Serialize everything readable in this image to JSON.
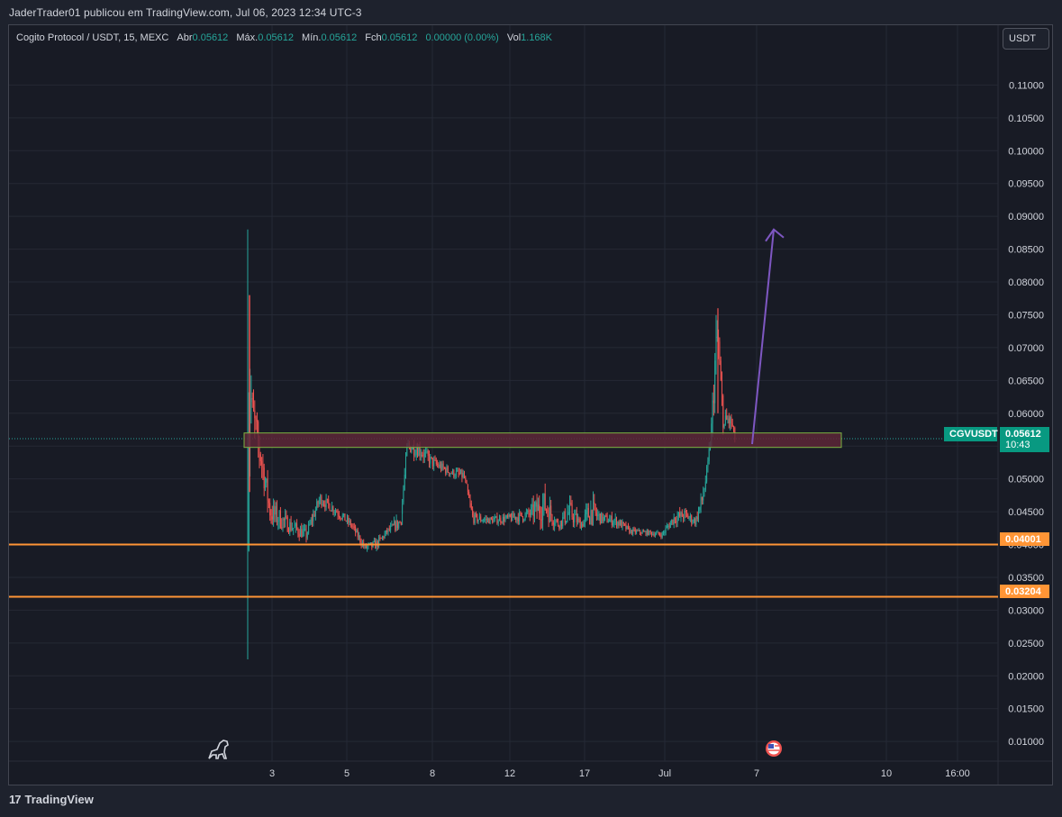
{
  "header": {
    "publish_line": "JaderTrader01 publicou em TradingView.com, Jul 06, 2023 12:34 UTC-3"
  },
  "legend": {
    "symbol": "Cogito Protocol / USDT, 15, MEXC",
    "open_label": "Abr",
    "open_value": "0.05612",
    "high_label": "Máx.",
    "high_value": "0.05612",
    "low_label": "Mín.",
    "low_value": "0.05612",
    "close_label": "Fch",
    "close_value": "0.05612",
    "change_value": "0.00000 (0.00%)",
    "volume_label": "Vol",
    "volume_value": "1.168K"
  },
  "currency_selector": "USDT",
  "footer": {
    "brand": "TradingView",
    "logo_glyph": "17"
  },
  "colors": {
    "background": "#181b25",
    "up": "#26a69a",
    "down": "#ef5350",
    "level_line": "#ff9536",
    "zone_border": "#7cb342",
    "zone_fill": "#5d2637",
    "arrow": "#7e57c2"
  },
  "chart_data": {
    "type": "candlestick",
    "title": "Cogito Protocol / USDT, 15, MEXC",
    "ylim": [
      0.007,
      0.115
    ],
    "y_ticks": [
      "0.11000",
      "0.10500",
      "0.10000",
      "0.09500",
      "0.09000",
      "0.08500",
      "0.08000",
      "0.07500",
      "0.07000",
      "0.06500",
      "0.06000",
      "0.05500",
      "0.05000",
      "0.04500",
      "0.04000",
      "0.03500",
      "0.03000",
      "0.02500",
      "0.02000",
      "0.01500",
      "0.01000"
    ],
    "x_ticks": [
      "3",
      "5",
      "8",
      "12",
      "17",
      "Jul",
      "7",
      "10",
      "16:00"
    ],
    "price_path": [
      {
        "x": "Jun 2",
        "open": 0.0553,
        "high": 0.088,
        "low": 0.0225,
        "close": 0.065
      },
      {
        "x": "Jun 2",
        "open": 0.065,
        "high": 0.078,
        "low": 0.048,
        "close": 0.052
      },
      {
        "x": "Jun 3",
        "open": 0.052,
        "high": 0.053,
        "low": 0.042,
        "close": 0.044
      },
      {
        "x": "Jun 4",
        "open": 0.044,
        "high": 0.049,
        "low": 0.0395,
        "close": 0.047
      },
      {
        "x": "Jun 5",
        "open": 0.047,
        "high": 0.048,
        "low": 0.04,
        "close": 0.042
      },
      {
        "x": "Jun 6",
        "open": 0.042,
        "high": 0.044,
        "low": 0.0385,
        "close": 0.0425
      },
      {
        "x": "Jun 7",
        "open": 0.0425,
        "high": 0.056,
        "low": 0.0415,
        "close": 0.055
      },
      {
        "x": "Jun 8",
        "open": 0.055,
        "high": 0.056,
        "low": 0.05,
        "close": 0.052
      },
      {
        "x": "Jun 9",
        "open": 0.052,
        "high": 0.0525,
        "low": 0.048,
        "close": 0.05
      },
      {
        "x": "Jun 10",
        "open": 0.05,
        "high": 0.051,
        "low": 0.0425,
        "close": 0.044
      },
      {
        "x": "Jun 12",
        "open": 0.044,
        "high": 0.045,
        "low": 0.0425,
        "close": 0.0435
      },
      {
        "x": "Jun 14",
        "open": 0.0435,
        "high": 0.047,
        "low": 0.042,
        "close": 0.0445
      },
      {
        "x": "Jun 16",
        "open": 0.0445,
        "high": 0.051,
        "low": 0.042,
        "close": 0.043
      },
      {
        "x": "Jun 18",
        "open": 0.043,
        "high": 0.05,
        "low": 0.042,
        "close": 0.044
      },
      {
        "x": "Jun 20",
        "open": 0.044,
        "high": 0.045,
        "low": 0.0415,
        "close": 0.042
      },
      {
        "x": "Jun 22",
        "open": 0.042,
        "high": 0.043,
        "low": 0.041,
        "close": 0.042
      },
      {
        "x": "Jun 24",
        "open": 0.042,
        "high": 0.046,
        "low": 0.041,
        "close": 0.044
      },
      {
        "x": "Jun 26",
        "open": 0.044,
        "high": 0.052,
        "low": 0.0425,
        "close": 0.044
      },
      {
        "x": "Jun 27",
        "open": 0.044,
        "high": 0.054,
        "low": 0.043,
        "close": 0.052
      },
      {
        "x": "Jun 28",
        "open": 0.052,
        "high": 0.076,
        "low": 0.05,
        "close": 0.062
      },
      {
        "x": "Jun 29",
        "open": 0.062,
        "high": 0.069,
        "low": 0.055,
        "close": 0.0561
      }
    ],
    "series": [
      {
        "name": "CGVUSDT",
        "last_price": "0.05612",
        "countdown": "10:43"
      }
    ],
    "horizontal_levels": [
      {
        "value": 0.04001,
        "label": "0.04001"
      },
      {
        "value": 0.03204,
        "label": "0.03204"
      }
    ],
    "zone": {
      "x_start": "Jun 2",
      "x_end": "Jul 9",
      "low": 0.0548,
      "high": 0.057
    },
    "arrow": {
      "from_x": "Jul 6",
      "from_y": 0.0553,
      "to_x": "Jul 7",
      "to_y": 0.088
    },
    "grid": true,
    "legend_position": "top-left"
  }
}
